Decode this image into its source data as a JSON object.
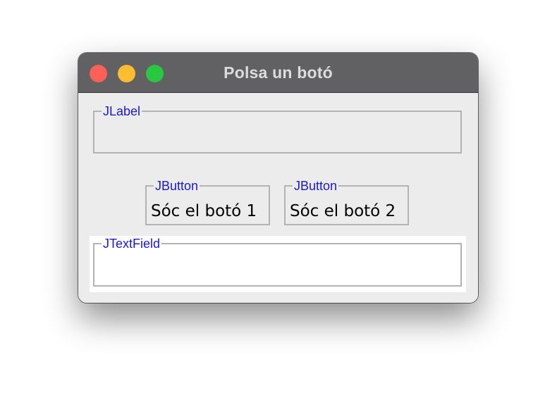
{
  "window": {
    "title": "Polsa un botó",
    "traffic_lights": {
      "close_color": "#fe5f57",
      "minimize_color": "#febc2e",
      "zoom_color": "#28c840"
    }
  },
  "label_panel": {
    "border_title": "JLabel",
    "text": ""
  },
  "buttons": [
    {
      "border_title": "JButton",
      "label": "Sóc el botó 1"
    },
    {
      "border_title": "JButton",
      "label": "Sóc el botó 2"
    }
  ],
  "text_field": {
    "border_title": "JTextField",
    "value": ""
  },
  "colors": {
    "border_title_color": "#1a16d6",
    "titlebar": "#616164",
    "window_background": "#ececec"
  }
}
